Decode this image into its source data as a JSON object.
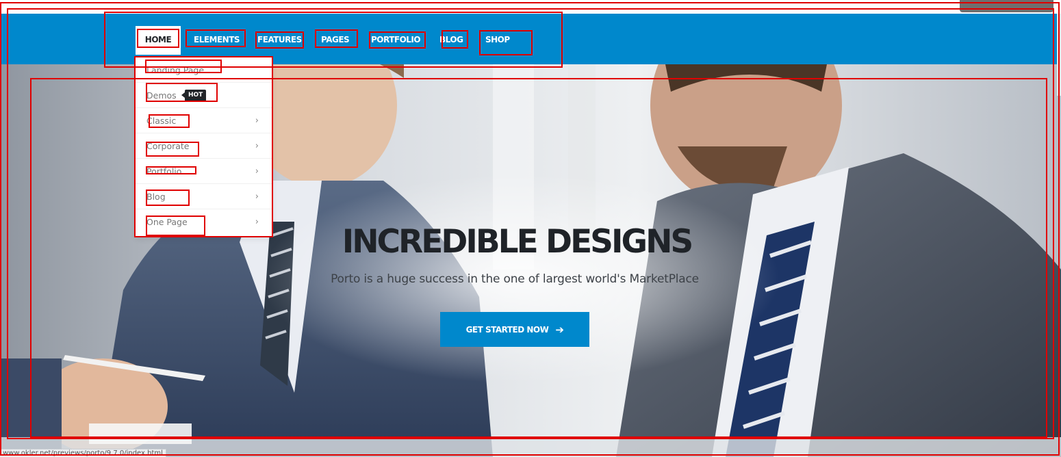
{
  "nav": {
    "items": [
      {
        "label": "HOME"
      },
      {
        "label": "ELEMENTS"
      },
      {
        "label": "FEATURES"
      },
      {
        "label": "PAGES"
      },
      {
        "label": "PORTFOLIO"
      },
      {
        "label": "BLOG"
      },
      {
        "label": "SHOP"
      }
    ]
  },
  "dropdown": {
    "items": [
      {
        "label": "Landing Page"
      },
      {
        "label": "Demos",
        "badge": "HOT"
      },
      {
        "label": "Classic"
      },
      {
        "label": "Corporate"
      },
      {
        "label": "Portfolio"
      },
      {
        "label": "Blog"
      },
      {
        "label": "One Page"
      }
    ],
    "submenu_icon": "chevron-right-icon"
  },
  "hero": {
    "title": "INCREDIBLE DESIGNS",
    "subtitle": "Porto is a huge success in the one of largest world's MarketPlace",
    "cta_label": "GET STARTED NOW",
    "cta_icon": "arrow-right-icon"
  },
  "status_bar": {
    "url": "www.okler.net/previews/porto/9.7.0/index.html"
  },
  "colors": {
    "primary": "#0088cc",
    "dark": "#222529",
    "annotation": "#e00000"
  }
}
